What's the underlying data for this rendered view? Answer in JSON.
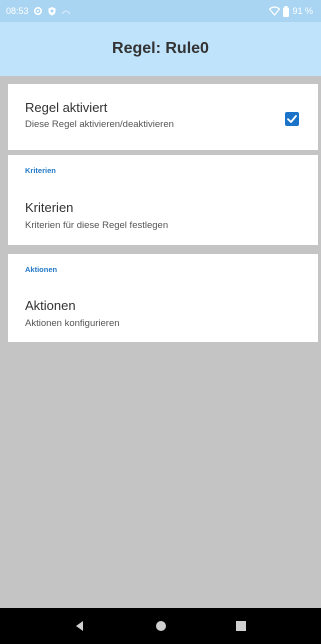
{
  "status_bar": {
    "time": "08:53",
    "battery": "91 %"
  },
  "app_bar": {
    "title": "Regel: Rule0"
  },
  "rule_enable": {
    "title": "Regel aktiviert",
    "subtitle": "Diese Regel aktivieren/deaktivieren",
    "checked": true
  },
  "criteria_section": {
    "header": "Kriterien",
    "title": "Kriterien",
    "subtitle": "Kriterien für diese Regel festlegen"
  },
  "actions_section": {
    "header": "Aktionen",
    "title": "Aktionen",
    "subtitle": "Aktionen konfigurieren"
  },
  "colors": {
    "app_bar": "#bfe3fb",
    "status_bar": "#a9d5f3",
    "accent": "#1a73c9",
    "background": "#c4c4c4"
  },
  "icons": {
    "status_left": [
      "settings-icon",
      "shield-icon",
      "signal-icon"
    ],
    "status_right": [
      "wifi-icon",
      "battery-icon"
    ],
    "nav": [
      "back-icon",
      "home-icon",
      "recents-icon"
    ]
  }
}
